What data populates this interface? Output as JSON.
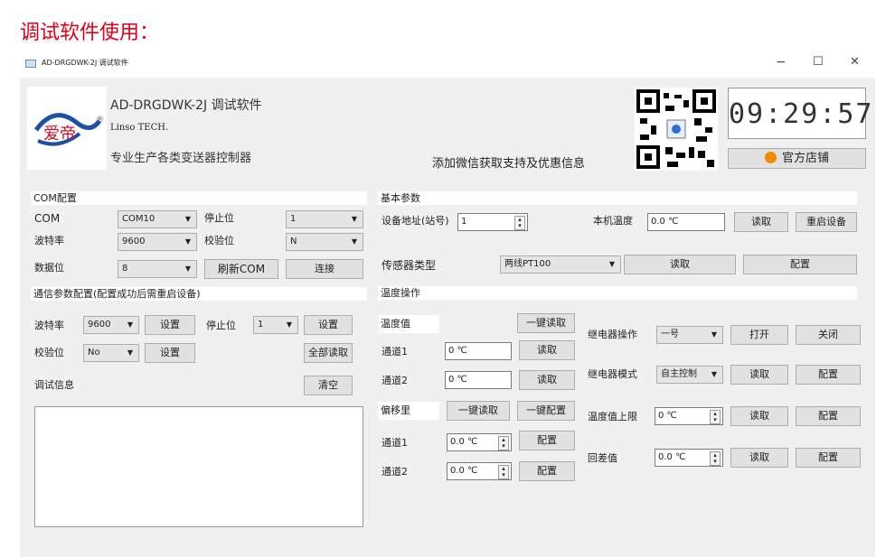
{
  "page_heading": "调试软件使用：",
  "window": {
    "title": "AD-DRGDWK-2J 调试软件",
    "controls": [
      "−",
      "☐",
      "✕"
    ]
  },
  "header": {
    "app_name": "AD-DRGDWK-2J 调试软件",
    "brand_cn": "爱帝",
    "brand_en": "Linso TECH.",
    "tagline": "专业生产各类变送器控制器",
    "wechat_text": "添加微信获取支持及优惠信息",
    "clock": "09:29:57",
    "shop_button": "官方店铺"
  },
  "com_config": {
    "title": "COM配置",
    "com_label": "COM",
    "com_value": "COM10",
    "stop_bit_label": "停止位",
    "stop_bit_value": "1",
    "baud_label": "波特率",
    "baud_value": "9600",
    "parity_label": "校验位",
    "parity_value": "N",
    "data_bits_label": "数据位",
    "data_bits_value": "8",
    "refresh_button": "刷新COM",
    "connect_button": "连接"
  },
  "comm_params": {
    "title": "通信参数配置(配置成功后需重启设备)",
    "baud_label": "波特率",
    "baud_value": "9600",
    "set_button": "设置",
    "stop_bit_label": "停止位",
    "stop_bit_value": "1",
    "parity_label": "校验位",
    "parity_value": "No",
    "read_all_button": "全部读取"
  },
  "debug": {
    "label": "调试信息",
    "clear_button": "清空"
  },
  "basic_params": {
    "title": "基本参数",
    "address_label": "设备地址(站号)",
    "address_value": "1",
    "local_temp_label": "本机温度",
    "local_temp_value": "0.0 ℃",
    "read_button": "读取",
    "restart_button": "重启设备",
    "sensor_type_label": "传感器类型",
    "sensor_type_value": "两线PT100",
    "config_button": "配置"
  },
  "temp_ops": {
    "title": "温度操作",
    "temp_value_label": "温度值",
    "one_key_read": "一键读取",
    "one_key_config": "一键配置",
    "channel1_label": "通道1",
    "channel2_label": "通道2",
    "ch1_temp": "0 ℃",
    "ch2_temp": "0 ℃",
    "offset_label": "偏移里",
    "ch1_offset": "0.0 ℃",
    "ch2_offset": "0.0 ℃",
    "read_button": "读取",
    "config_button": "配置",
    "relay_op_label": "继电器操作",
    "relay_op_value": "一号",
    "open_button": "打开",
    "close_button": "关闭",
    "relay_mode_label": "继电器模式",
    "relay_mode_value": "自主控制",
    "upper_limit_label": "温度值上限",
    "upper_limit_value": "0 ℃",
    "hysteresis_label": "回差值",
    "hysteresis_value": "0.0 ℃"
  }
}
